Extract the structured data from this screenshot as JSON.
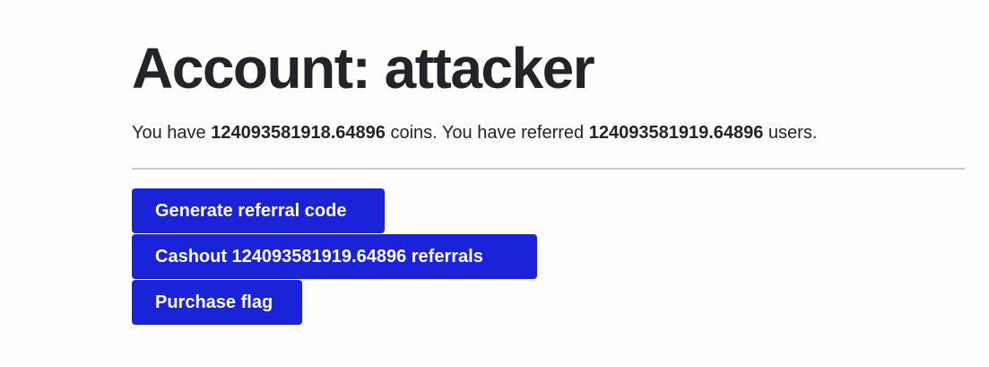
{
  "account": {
    "title_prefix": "Account: ",
    "username": "attacker"
  },
  "summary": {
    "text_1": "You have ",
    "coins": "124093581918.64896",
    "text_2": " coins. You have referred ",
    "referrals": "124093581919.64896",
    "text_3": " users."
  },
  "actions": {
    "generate_label": "Generate referral code",
    "cashout_label": "Cashout 124093581919.64896 referrals",
    "purchase_label": "Purchase flag"
  },
  "colors": {
    "button_bg": "#1a23d8",
    "button_text": "#ffffff",
    "page_bg": "#fdfdfd",
    "text": "#212529"
  }
}
